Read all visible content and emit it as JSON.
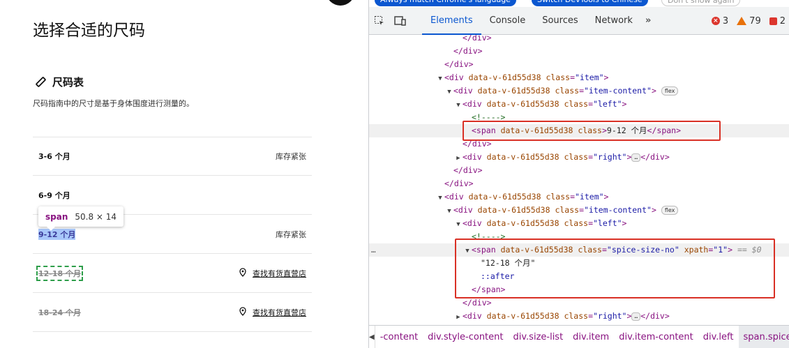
{
  "page": {
    "title": "选择合适的尺码",
    "size_chart_heading": "尺码表",
    "size_chart_desc": "尺码指南中的尺寸是基于身体围度进行测量的。",
    "sizes": [
      {
        "label": "3-6 个月",
        "status": "库存紧张"
      },
      {
        "label": "6-9 个月",
        "status": ""
      },
      {
        "label": "9-12 个月",
        "status": "库存紧张"
      },
      {
        "label": "12-18 个月",
        "status": "查找有货直营店"
      },
      {
        "label": "18-24 个月",
        "status": "查找有货直营店"
      }
    ],
    "tooltip": {
      "tag": "span",
      "dims": "50.8 × 14"
    }
  },
  "devtools": {
    "infobar": {
      "btn1": "Always match Chrome's language",
      "btn2": "Switch DevTools to Chinese",
      "btn3": "Don't show again"
    },
    "tabs": [
      "Elements",
      "Console",
      "Sources",
      "Network"
    ],
    "more": "»",
    "counts": {
      "errors": "3",
      "warnings": "79",
      "issues": "2"
    },
    "badge_flex": "flex",
    "badge_ellipsis": "…",
    "gutter": "…",
    "eq_marker": "== $0",
    "attr_name": "data-v-61d55d38",
    "tree": {
      "close_div": "</div>",
      "open_div": "<div",
      "open_span": "<span",
      "class_attr": "class",
      "eq": "=",
      "gt": ">",
      "close_span": "</span>",
      "item_class": "\"item\"",
      "item_content_class": "\"item-content\"",
      "left_class": "\"left\"",
      "right_class": "\"right\"",
      "comment": "<!---->",
      "span_text_1": "9-12 个月",
      "spice_class": "\"spice-size-no\"",
      "xpath_name": "xpath",
      "xpath_val": "\"1\"",
      "span_text_2": "\"12-18 个月\"",
      "after": "::after"
    },
    "breadcrumbs": [
      "-content",
      "div.style-content",
      "div.size-list",
      "div.item",
      "div.item-content",
      "div.left",
      "span.spice"
    ]
  }
}
